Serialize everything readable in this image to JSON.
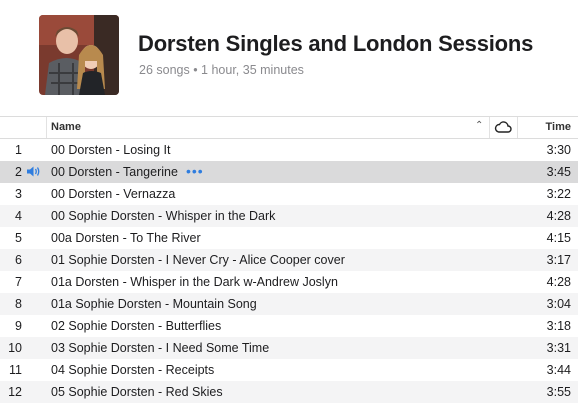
{
  "playlist": {
    "title": "Dorsten Singles and London Sessions",
    "subtitle": "26 songs • 1 hour, 35 minutes"
  },
  "columns": {
    "name": "Name",
    "time": "Time"
  },
  "icons": {
    "sort": "chevron-up-icon",
    "cloud": "cloud-icon",
    "speaker": "speaker-playing-icon",
    "more": "more-dots-icon"
  },
  "colors": {
    "accent": "#2f7ddf",
    "selected_row": "#dadadb",
    "stripe": "#f4f4f5"
  },
  "now_playing_index": 1,
  "tracks": [
    {
      "num": "1",
      "name": "00 Dorsten - Losing It",
      "time": "3:30"
    },
    {
      "num": "2",
      "name": "00 Dorsten - Tangerine",
      "time": "3:45",
      "more": "•••"
    },
    {
      "num": "3",
      "name": "00 Dorsten - Vernazza",
      "time": "3:22"
    },
    {
      "num": "4",
      "name": "00 Sophie Dorsten - Whisper in the Dark",
      "time": "4:28"
    },
    {
      "num": "5",
      "name": "00a Dorsten - To The River",
      "time": "4:15"
    },
    {
      "num": "6",
      "name": "01 Sophie Dorsten - I Never Cry - Alice Cooper cover",
      "time": "3:17"
    },
    {
      "num": "7",
      "name": "01a Dorsten - Whisper in the Dark w-Andrew Joslyn",
      "time": "4:28"
    },
    {
      "num": "8",
      "name": "01a Sophie Dorsten - Mountain Song",
      "time": "3:04"
    },
    {
      "num": "9",
      "name": "02 Sophie Dorsten - Butterflies",
      "time": "3:18"
    },
    {
      "num": "10",
      "name": "03 Sophie Dorsten - I Need Some Time",
      "time": "3:31"
    },
    {
      "num": "11",
      "name": "04 Sophie Dorsten - Receipts",
      "time": "3:44"
    },
    {
      "num": "12",
      "name": "05 Sophie Dorsten - Red Skies",
      "time": "3:55"
    }
  ]
}
